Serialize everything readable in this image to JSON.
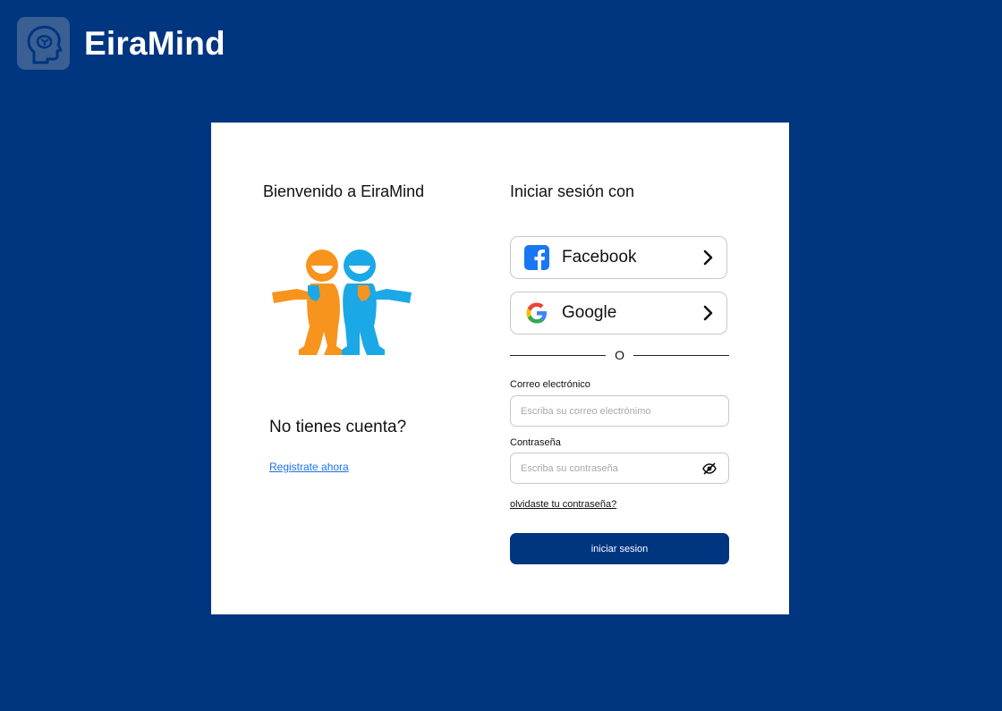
{
  "app": {
    "name": "EiraMind",
    "logo_icon": "brain-head-icon"
  },
  "welcome": {
    "title": "Bienvenido a EiraMind",
    "illustration": "two-people-hugging-illustration"
  },
  "register": {
    "question": "No tienes cuenta?",
    "link": "Registrate ahora"
  },
  "login": {
    "title": "Iniciar sesión con",
    "facebook": {
      "label": "Facebook",
      "icon": "facebook-icon"
    },
    "google": {
      "label": "Google",
      "icon": "google-icon"
    },
    "divider": "O",
    "email": {
      "label": "Correo electrónico",
      "value": "",
      "placeholder": "Escriba su correo electrónimo"
    },
    "password": {
      "label": "Contraseña",
      "value": "",
      "placeholder": "Escriba su contraseña",
      "toggle_icon": "eye-off-icon"
    },
    "forgot": "olvidaste tu contraseña?",
    "submit": "iniciar sesion"
  },
  "colors": {
    "background": "#003580",
    "primary_button": "#003580",
    "link": "#1a73e8",
    "facebook": "#1877f2",
    "mascot_orange": "#f7941d",
    "mascot_blue": "#1ba8e6"
  }
}
